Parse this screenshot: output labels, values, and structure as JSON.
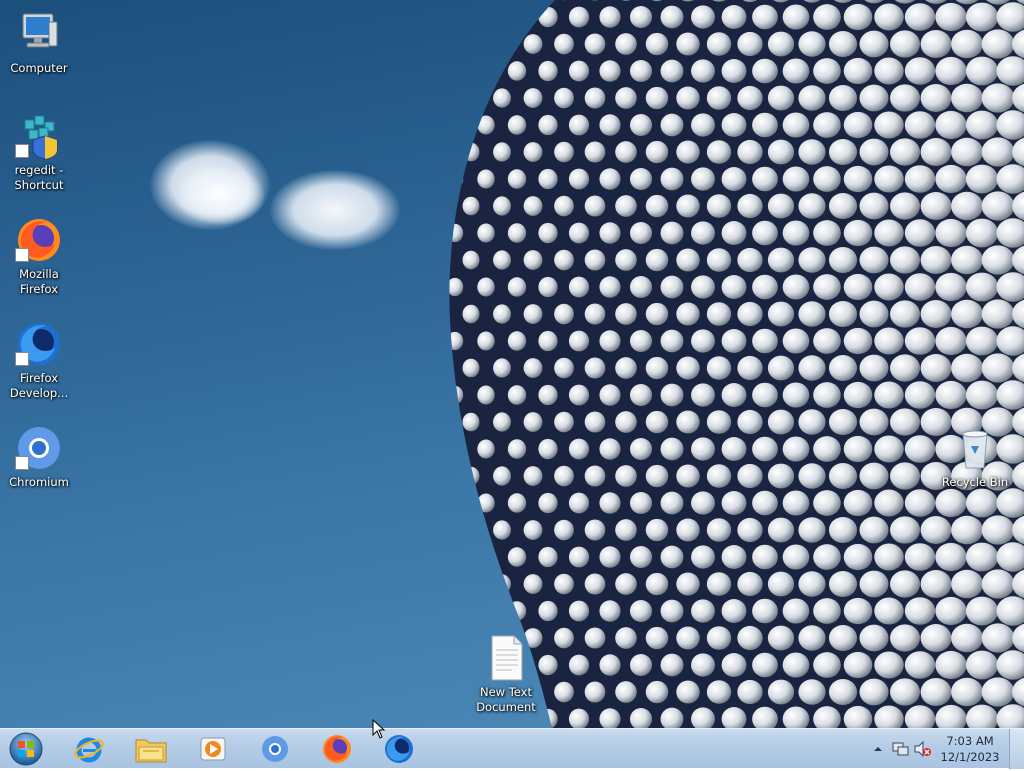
{
  "desktop": {
    "icons": [
      {
        "label": "Computer"
      },
      {
        "label": "regedit - Shortcut"
      },
      {
        "label": "Mozilla Firefox"
      },
      {
        "label": "Firefox Develop..."
      },
      {
        "label": "Chromium"
      },
      {
        "label": "Recycle Bin"
      },
      {
        "label": "New Text Document"
      }
    ]
  },
  "taskbar": {
    "pinned": [
      {
        "icon": "internet-explorer-icon"
      },
      {
        "icon": "file-explorer-icon"
      },
      {
        "icon": "media-player-icon"
      },
      {
        "icon": "chromium-icon"
      },
      {
        "icon": "firefox-icon"
      },
      {
        "icon": "firefox-developer-icon"
      }
    ],
    "clock": {
      "time": "7:03 AM",
      "date": "12/1/2023"
    }
  },
  "colors": {
    "sky": "#2d6595",
    "taskbar": "#b5cde6"
  }
}
